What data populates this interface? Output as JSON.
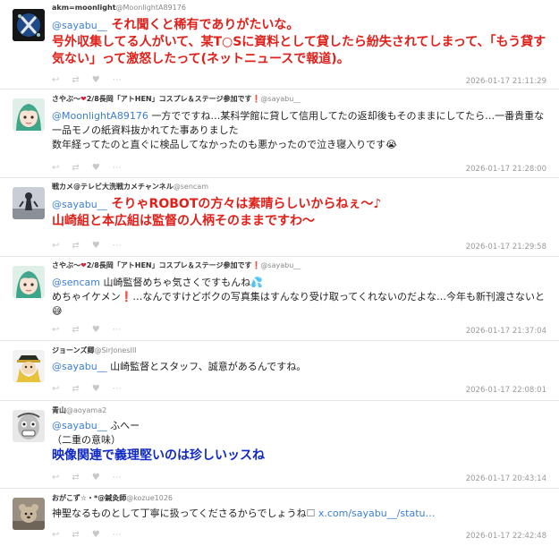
{
  "tweets": [
    {
      "display_name": "akm=moonlight",
      "handle": "@MoonlightA89176",
      "mention": "@sayabu__",
      "line1": " それ聞くと稀有でありがたいな。",
      "line2": "号外収集してる人がいて、某T○Sに資料として貸したら紛失されてしまって、「もう貸す気ない」って激怒したって(ネットニュースで報道)。",
      "timestamp": "2026-01-17 21:11:29"
    },
    {
      "display_name": "さやぶ〜",
      "display_name_suffix": "2/8長岡「アトHEN」コスプレ＆ステージ参加です",
      "handle": "@sayabu__",
      "mention": "@MoonlightA89176",
      "line1": " 一方でですね…某科学館に貸して信用してたの返却後もそのままにしてたら…一番貴重な一品モノの紙資料抜かれてた事ありました",
      "line2": "数年経ってたのと直ぐに検品してなかったのも悪かったので泣き寝入りです",
      "emoji": "😭",
      "timestamp": "2026-01-17 21:28:00"
    },
    {
      "display_name": "戦カメ@テレビ大洗戦カメチャンネル",
      "handle": "@sencam",
      "mention": "@sayabu__",
      "line1": " そりゃROBOTの方々は素晴らしいからねぇ～♪",
      "line2": "山崎組と本広組は監督の人柄そのままですわ～",
      "timestamp": "2026-01-17 21:29:58"
    },
    {
      "display_name": "さやぶ〜",
      "display_name_suffix": "2/8長岡「アトHEN」コスプレ＆ステージ参加です",
      "handle": "@sayabu__",
      "mention": "@sencam",
      "line1": " 山崎監督めちゃ気さくですもんね",
      "line1_emoji": "💦",
      "line2": "めちゃイケメン",
      "line2_mark": "❗",
      "line2_rest": "…なんですけどボクの写真集はすんなり受け取ってくれないのだよな…今年も新刊渡さないと",
      "emoji": "😅",
      "timestamp": "2026-01-17 21:37:04"
    },
    {
      "display_name": "ジョーンズ卿",
      "handle": "@SirJonesIII",
      "mention": "@sayabu__",
      "line1": " 山崎監督とスタッフ、誠意があるんですね。",
      "timestamp": "2026-01-17 22:08:01"
    },
    {
      "display_name": "青山",
      "handle": "@aoyama2",
      "mention": "@sayabu__",
      "line1": " ふへー",
      "line2": "（二重の意味）",
      "line3": "映像関連で義理堅いのは珍しいッスね",
      "timestamp": "2026-01-17 20:43:14"
    },
    {
      "display_name": "おがこず☆・*@鍼灸師",
      "handle": "@kozue1026",
      "line1": "神聖なるものとして丁寧に扱ってくださるからでしょうね",
      "link": "x.com/sayabu__/statu…",
      "timestamp": "2026-01-17 22:42:48"
    }
  ],
  "actions": {
    "reply": "↩",
    "retweet": "⇄",
    "like": "♥",
    "more": "⋯"
  },
  "colors": {
    "accent_red": "#e0201a",
    "accent_blue": "#1028c8",
    "link": "#3b7fd4"
  }
}
